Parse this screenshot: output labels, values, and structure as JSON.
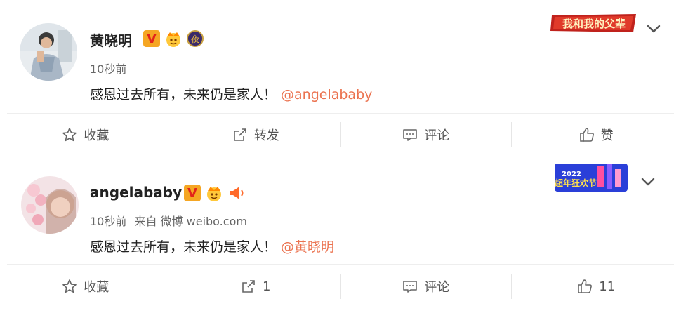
{
  "posts": [
    {
      "author": "黄晓明",
      "time": "10秒前",
      "source": "",
      "text": "感恩过去所有，未来仍是家人！",
      "mention": "@angelababy",
      "badge_v": "V",
      "badge_ye": "夜",
      "deco_text": "我和我的父辈",
      "actions": {
        "favorite": "收藏",
        "repost": "转发",
        "comment": "评论",
        "like": "赞"
      }
    },
    {
      "author": "angelababy",
      "time": "10秒前",
      "source": "来自 微博 weibo.com",
      "text": "感恩过去所有，未来仍是家人！",
      "mention": "@黄晓明",
      "badge_v": "V",
      "deco_year": "2022",
      "deco_text": "超年狂欢节",
      "actions": {
        "favorite": "收藏",
        "repost": "1",
        "comment": "评论",
        "like": "11"
      }
    }
  ],
  "colors": {
    "mention": "#eb7350",
    "text": "#222222",
    "meta": "#666666"
  },
  "icons": [
    "star-icon",
    "share-icon",
    "comment-icon",
    "thumb-up-icon",
    "chevron-down-icon"
  ]
}
